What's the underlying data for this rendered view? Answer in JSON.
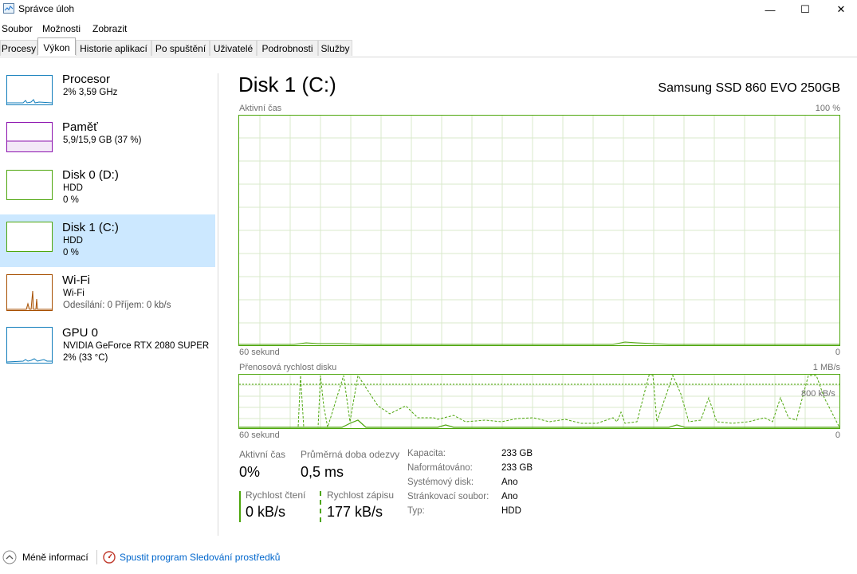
{
  "window": {
    "title": "Správce úloh",
    "controls": [
      "—",
      "☐",
      "✕"
    ]
  },
  "menu": [
    "Soubor",
    "Možnosti",
    "Zobrazit"
  ],
  "tabs": [
    "Procesy",
    "Výkon",
    "Historie aplikací",
    "Po spuštění",
    "Uživatelé",
    "Podrobnosti",
    "Služby"
  ],
  "active_tab": "Výkon",
  "sidebar": {
    "items": [
      {
        "title": "Procesor",
        "line1": "2% 3,59 GHz",
        "line2": "",
        "color": "#117dbb"
      },
      {
        "title": "Paměť",
        "line1": "5,9/15,9 GB (37 %)",
        "line2": "",
        "color": "#8b12ae"
      },
      {
        "title": "Disk 0 (D:)",
        "line1": "HDD",
        "line2": "0 %",
        "color": "#4da60c"
      },
      {
        "title": "Disk 1 (C:)",
        "line1": "HDD",
        "line2": "0 %",
        "color": "#4da60c"
      },
      {
        "title": "Wi-Fi",
        "line1": "Wi-Fi",
        "line2": "Odesílání: 0 Příjem: 0 kb/s",
        "color": "#a74f01"
      },
      {
        "title": "GPU 0",
        "line1": "NVIDIA GeForce RTX 2080 SUPER",
        "line2": "2% (33 °C)",
        "color": "#117dbb"
      }
    ],
    "selected_index": 3
  },
  "main": {
    "title": "Disk 1 (C:)",
    "model": "Samsung SSD 860 EVO 250GB",
    "graph1": {
      "label": "Aktivní čas",
      "max": "100 %",
      "time": "60 sekund",
      "min": "0"
    },
    "graph2": {
      "label": "Přenosová rychlost disku",
      "max": "1 MB/s",
      "mid": "800 kB/s",
      "time": "60 sekund",
      "min": "0"
    },
    "stats": {
      "active_label": "Aktivní čas",
      "active_value": "0%",
      "response_label": "Průměrná doba odezvy",
      "response_value": "0,5 ms",
      "read_label": "Rychlost čtení",
      "read_value": "0 kB/s",
      "write_label": "Rychlost zápisu",
      "write_value": "177 kB/s"
    },
    "details": [
      {
        "label": "Kapacita:",
        "value": "233 GB"
      },
      {
        "label": "Naformátováno:",
        "value": "233 GB"
      },
      {
        "label": "Systémový disk:",
        "value": "Ano"
      },
      {
        "label": "Stránkovací soubor:",
        "value": "Ano"
      },
      {
        "label": "Typ:",
        "value": "HDD"
      }
    ]
  },
  "footer": {
    "less_info": "Méně informací",
    "resource_monitor": "Spustit program Sledování prostředků"
  },
  "colors": {
    "disk_green": "#4da60c",
    "grid_green": "#d9eacb",
    "selected_bg": "#cce8ff",
    "link_blue": "#0066cc"
  }
}
